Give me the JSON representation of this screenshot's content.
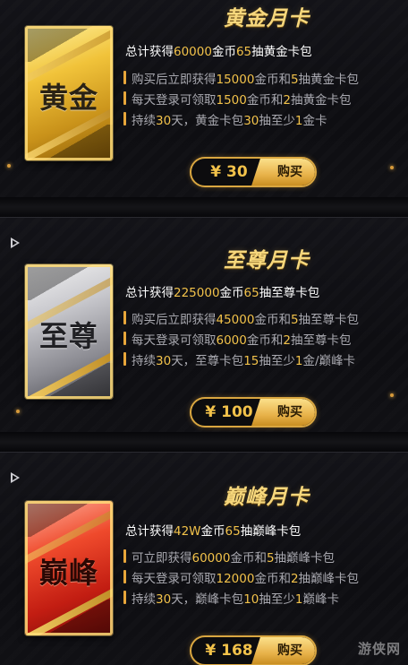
{
  "cards": [
    {
      "title": "黄金月卡",
      "card_label": "黄金",
      "summary_pre": "总计获得",
      "summary_hl1": "60000",
      "summary_mid": "金币",
      "summary_hl2": "65",
      "summary_post": "抽黄金卡包",
      "bullets": [
        {
          "a": "购买后立即获得",
          "b": "15000",
          "c": "金币和",
          "d": "5",
          "e": "抽黄金卡包"
        },
        {
          "a": "每天登录可领取",
          "b": "1500",
          "c": "金币和",
          "d": "2",
          "e": "抽黄金卡包"
        },
        {
          "a": "持续",
          "b": "30",
          "c": "天，黄金卡包",
          "d": "30",
          "e": "抽至少",
          "f": "1",
          "g": "金卡"
        }
      ],
      "price": "¥ 30",
      "buy_label": "购买"
    },
    {
      "title": "至尊月卡",
      "card_label": "至尊",
      "summary_pre": "总计获得",
      "summary_hl1": "225000",
      "summary_mid": "金币",
      "summary_hl2": "65",
      "summary_post": "抽至尊卡包",
      "bullets": [
        {
          "a": "购买后立即获得",
          "b": "45000",
          "c": "金币和",
          "d": "5",
          "e": "抽至尊卡包"
        },
        {
          "a": "每天登录可领取",
          "b": "6000",
          "c": "金币和",
          "d": "2",
          "e": "抽至尊卡包"
        },
        {
          "a": "持续",
          "b": "30",
          "c": "天，至尊卡包",
          "d": "15",
          "e": "抽至少",
          "f": "1",
          "g": "金/巅峰卡"
        }
      ],
      "price": "¥ 100",
      "buy_label": "购买"
    },
    {
      "title": "巅峰月卡",
      "card_label": "巅峰",
      "summary_pre": "总计获得",
      "summary_hl1": "42W",
      "summary_mid": "金币",
      "summary_hl2": "65",
      "summary_post": "抽巅峰卡包",
      "bullets": [
        {
          "a": "可立即获得",
          "b": "60000",
          "c": "金币和",
          "d": "5",
          "e": "抽巅峰卡包"
        },
        {
          "a": "每天登录可领取",
          "b": "12000",
          "c": "金币和",
          "d": "2",
          "e": "抽巅峰卡包"
        },
        {
          "a": "持续",
          "b": "30",
          "c": "天，巅峰卡包",
          "d": "10",
          "e": "抽至少",
          "f": "1",
          "g": "巅峰卡"
        }
      ],
      "price": "¥ 168",
      "buy_label": "购买"
    }
  ],
  "watermark": "游侠网",
  "colors": {
    "gold_text": "#f2c24a",
    "title": "#f6d77c",
    "bullet_bar": "#e8a63a",
    "button_border": "#d9a640"
  }
}
